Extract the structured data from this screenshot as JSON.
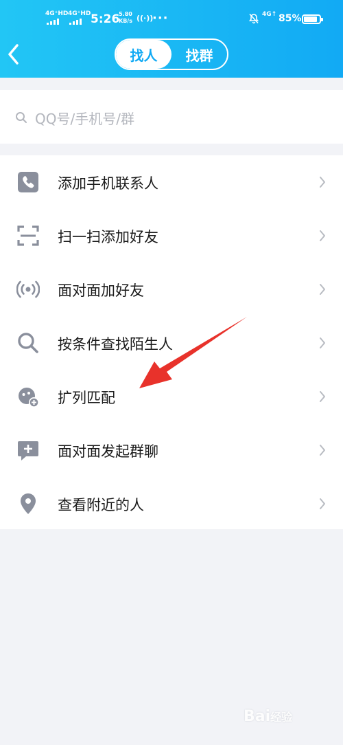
{
  "status_bar": {
    "network1": "4G⁺HD",
    "network2": "4G⁺HD",
    "time": "5:26",
    "speed_value": "5.80",
    "speed_unit": "KB/s",
    "dots": "···",
    "network3": "4G↑",
    "battery_percent": "85%",
    "battery_level": 0.85
  },
  "header": {
    "tabs": [
      {
        "label": "找人",
        "active": true
      },
      {
        "label": "找群",
        "active": false
      }
    ],
    "back_icon": "chevron-left-icon"
  },
  "search": {
    "placeholder": "QQ号/手机号/群",
    "icon": "search-icon"
  },
  "menu": {
    "items": [
      {
        "label": "添加手机联系人",
        "icon": "phone-icon"
      },
      {
        "label": "扫一扫添加好友",
        "icon": "scan-icon"
      },
      {
        "label": "面对面加好友",
        "icon": "radar-icon"
      },
      {
        "label": "按条件查找陌生人",
        "icon": "search-icon"
      },
      {
        "label": "扩列匹配",
        "icon": "match-icon"
      },
      {
        "label": "面对面发起群聊",
        "icon": "group-chat-icon"
      },
      {
        "label": "查看附近的人",
        "icon": "location-pin-icon"
      }
    ]
  },
  "colors": {
    "header_gradient_start": "#22c6f5",
    "header_gradient_end": "#12aaf4",
    "icon_gray": "#8a8f9c",
    "annotation_red": "#e8322b"
  },
  "watermark": {
    "text": "Bai",
    "sub": "经验"
  }
}
